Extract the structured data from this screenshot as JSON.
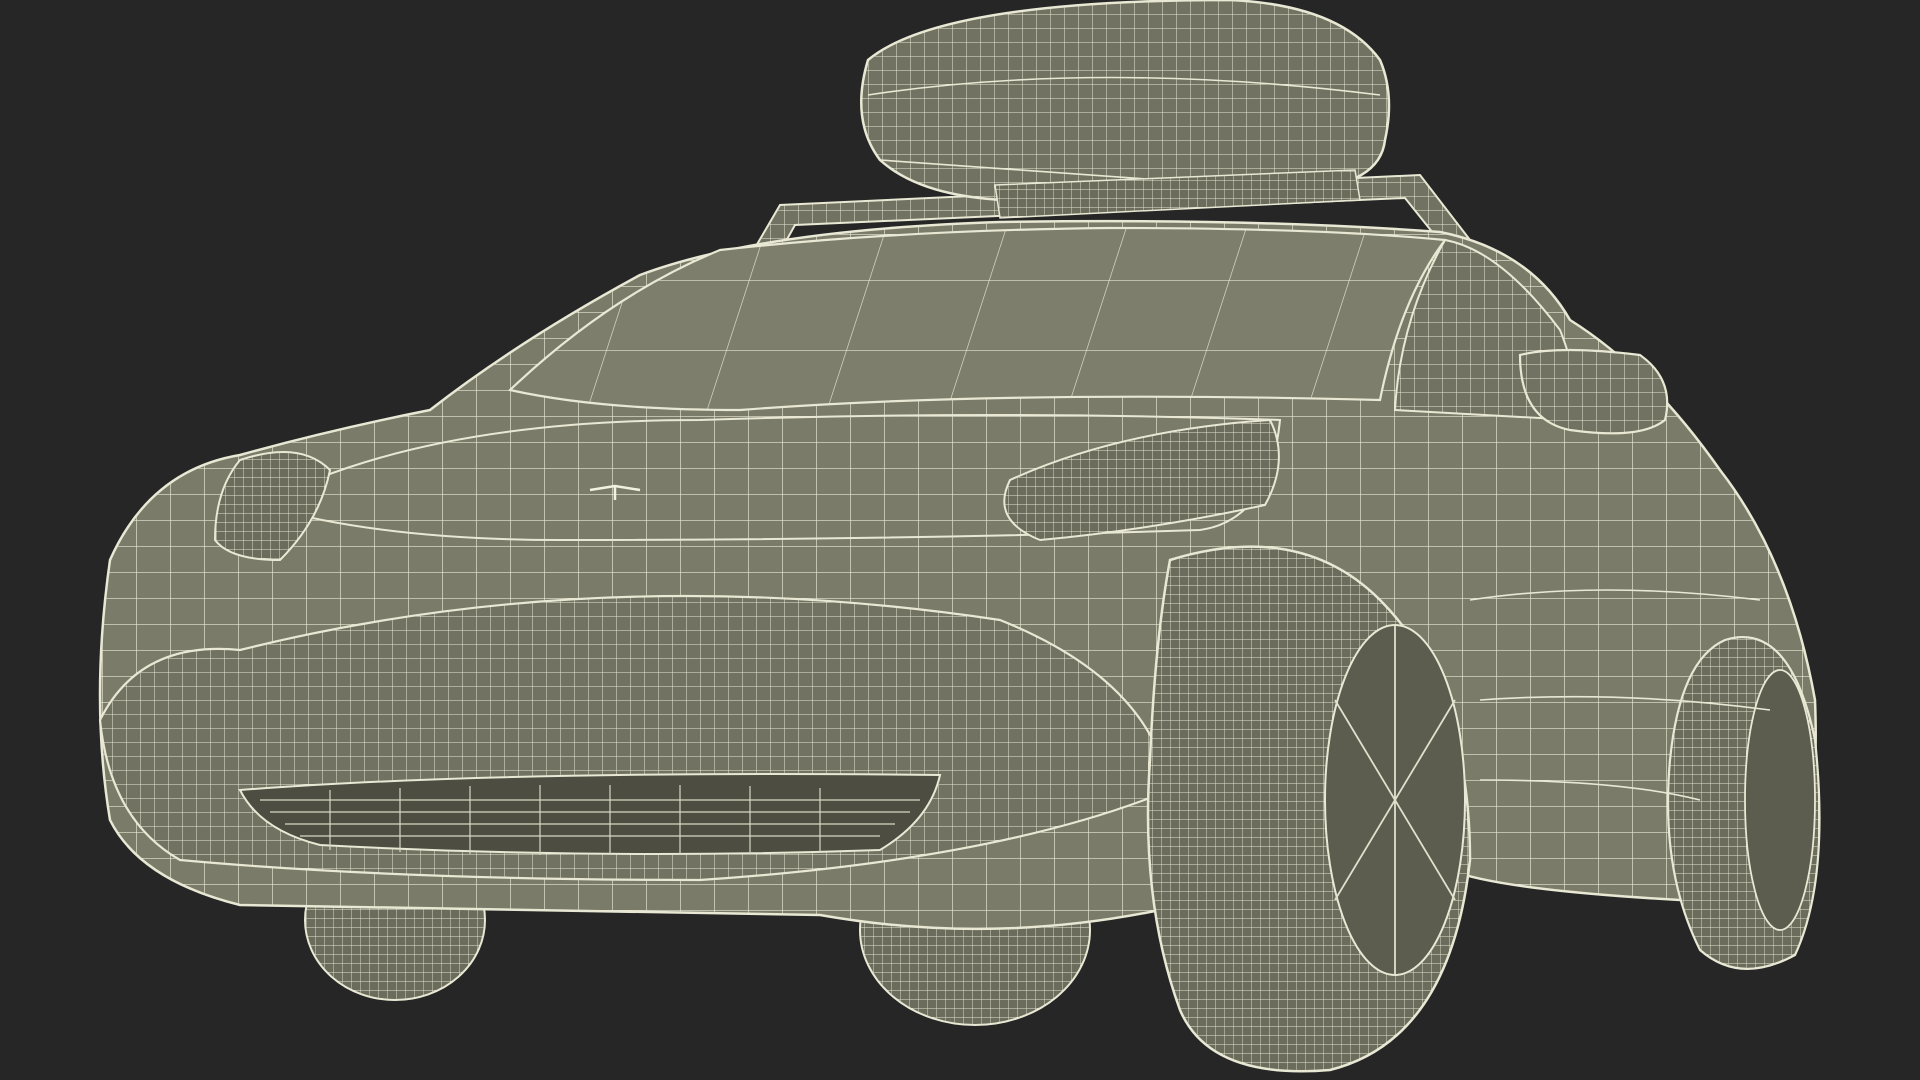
{
  "scene": {
    "subject": "car-wireframe-render",
    "colors": {
      "background": "#262626",
      "body_fill": "#7b7b6a",
      "body_fill_dark": "#5f5f52",
      "shadow_fill": "#4a4a40",
      "wire": "#e8e8d4",
      "wire_dim": "#cfcfbc"
    },
    "elements": [
      "roof-cargo-box",
      "roof-rack",
      "windshield",
      "car-hood",
      "side-mirror",
      "headlight-left",
      "headlight-right",
      "front-bumper",
      "lower-grille",
      "front-wheel-right",
      "rear-wheel-right",
      "front-wheel-left",
      "rear-wheel-left"
    ]
  }
}
